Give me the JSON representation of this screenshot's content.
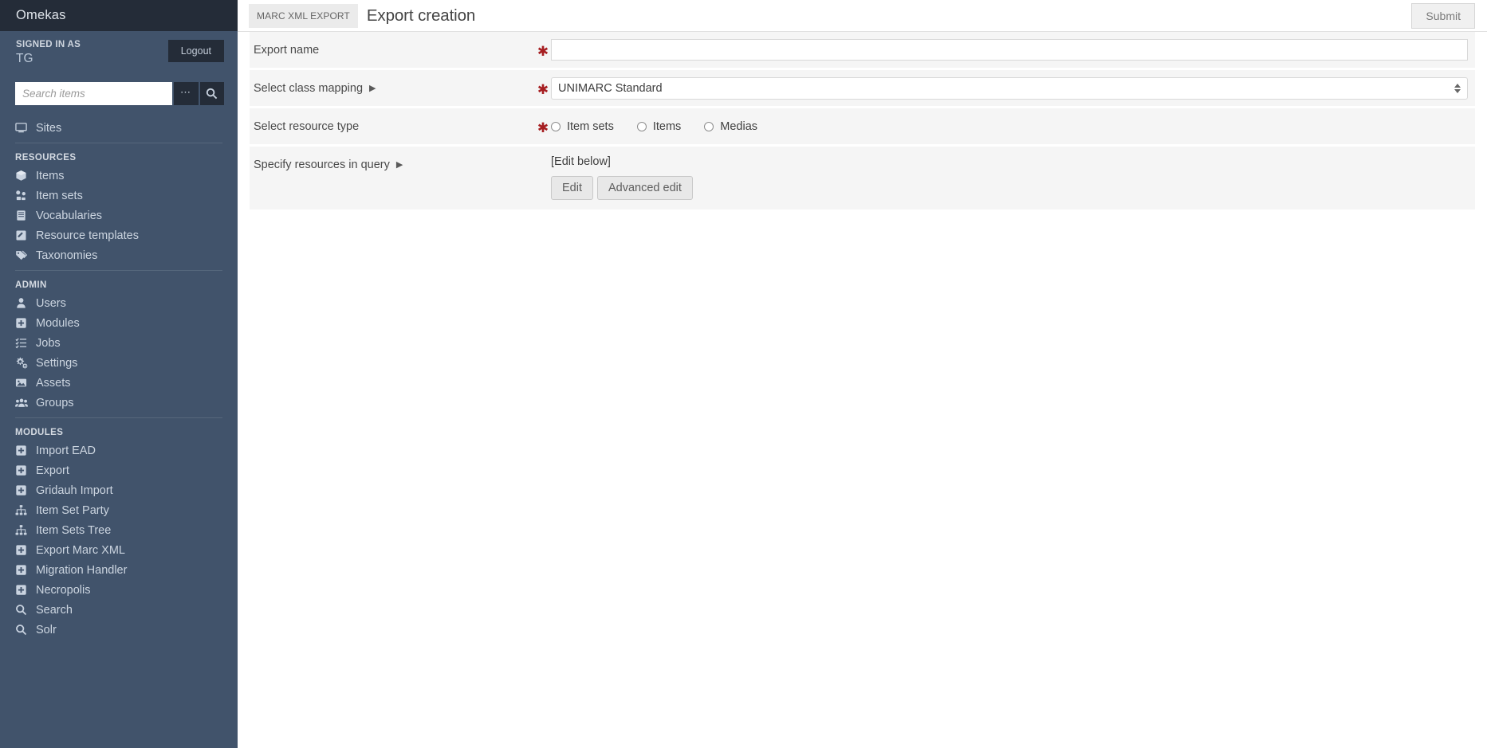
{
  "sidebar": {
    "brand": "Omekas",
    "signed_in_label": "SIGNED IN AS",
    "user_name": "TG",
    "logout_label": "Logout",
    "search": {
      "placeholder": "Search items",
      "value": "",
      "advanced_icon": "ellipsis-icon",
      "submit_icon": "search-icon"
    },
    "groups": [
      {
        "title": "",
        "items": [
          {
            "label": "Sites",
            "icon": "desktop-icon"
          }
        ]
      },
      {
        "title": "RESOURCES",
        "items": [
          {
            "label": "Items",
            "icon": "cube-icon"
          },
          {
            "label": "Item sets",
            "icon": "item-sets-icon"
          },
          {
            "label": "Vocabularies",
            "icon": "book-icon"
          },
          {
            "label": "Resource templates",
            "icon": "pencil-square-icon"
          },
          {
            "label": "Taxonomies",
            "icon": "tags-icon"
          }
        ]
      },
      {
        "title": "ADMIN",
        "items": [
          {
            "label": "Users",
            "icon": "user-icon"
          },
          {
            "label": "Modules",
            "icon": "puzzle-icon"
          },
          {
            "label": "Jobs",
            "icon": "tasks-icon"
          },
          {
            "label": "Settings",
            "icon": "gears-icon"
          },
          {
            "label": "Assets",
            "icon": "image-icon"
          },
          {
            "label": "Groups",
            "icon": "users-icon"
          }
        ]
      },
      {
        "title": "MODULES",
        "items": [
          {
            "label": "Import EAD",
            "icon": "puzzle-icon"
          },
          {
            "label": "Export",
            "icon": "puzzle-icon"
          },
          {
            "label": "Gridauh Import",
            "icon": "puzzle-icon"
          },
          {
            "label": "Item Set Party",
            "icon": "sitemap-icon"
          },
          {
            "label": "Item Sets Tree",
            "icon": "sitemap-icon"
          },
          {
            "label": "Export Marc XML",
            "icon": "puzzle-icon"
          },
          {
            "label": "Migration Handler",
            "icon": "puzzle-icon"
          },
          {
            "label": "Necropolis",
            "icon": "puzzle-icon"
          },
          {
            "label": "Search",
            "icon": "search-icon"
          },
          {
            "label": "Solr",
            "icon": "search-icon"
          }
        ]
      }
    ]
  },
  "header": {
    "breadcrumb": "MARC XML EXPORT",
    "title": "Export creation",
    "submit_label": "Submit"
  },
  "form": {
    "required_marker": "✱",
    "fields": [
      {
        "label": "Export name",
        "required": true,
        "type": "text",
        "value": "",
        "placeholder": ""
      },
      {
        "label": "Select class mapping",
        "required": true,
        "type": "select",
        "selected": "UNIMARC Standard",
        "collapse_icon": "caret-right-icon"
      },
      {
        "label": "Select resource type",
        "required": true,
        "type": "radio",
        "options": [
          {
            "label": "Item sets",
            "checked": false
          },
          {
            "label": "Items",
            "checked": false
          },
          {
            "label": "Medias",
            "checked": false
          }
        ]
      },
      {
        "label": "Specify resources in query",
        "required": false,
        "type": "query",
        "value": "[Edit below]",
        "collapse_icon": "caret-right-icon",
        "buttons": [
          {
            "label": "Edit"
          },
          {
            "label": "Advanced edit"
          }
        ]
      }
    ]
  },
  "colors": {
    "sidebar_bg": "#41536b",
    "sidebar_dark": "#242c38",
    "required_red": "#a61e21",
    "field_bg": "#f5f5f5"
  }
}
